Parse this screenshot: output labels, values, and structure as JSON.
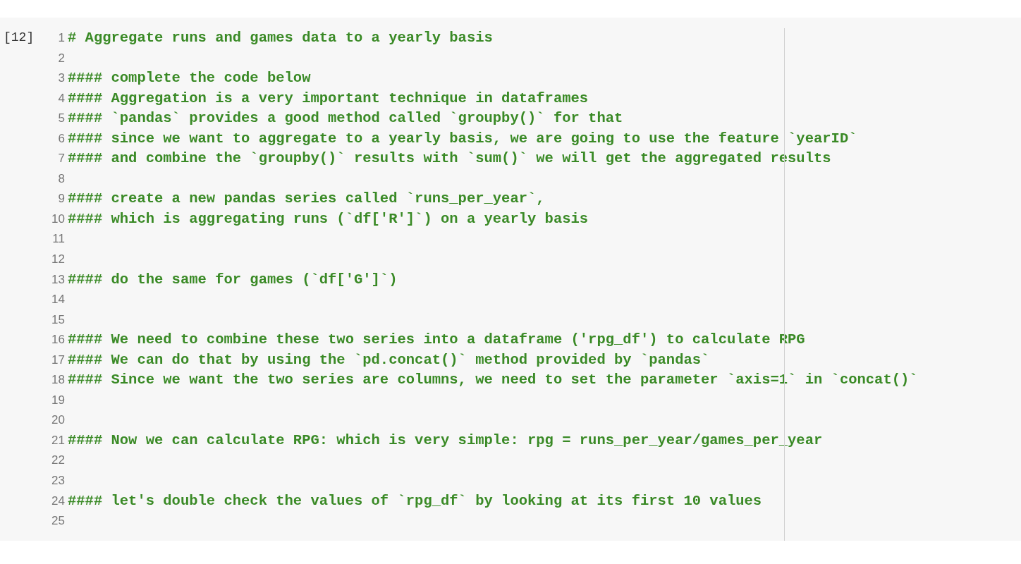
{
  "cell": {
    "execution_count": "[12]",
    "lines": [
      {
        "number": "1",
        "text": "# Aggregate runs and games data to a yearly basis"
      },
      {
        "number": "2"
      },
      {
        "number": "3",
        "text": "#### complete the code below"
      },
      {
        "number": "4",
        "text": "#### Aggregation is a very important technique in dataframes"
      },
      {
        "number": "5",
        "text": "#### `pandas` provides a good method called `groupby()` for that"
      },
      {
        "number": "6",
        "text": "#### since we want to aggregate to a yearly basis, we are going to use the feature `yearID`"
      },
      {
        "number": "7",
        "text": "#### and combine the `groupby()` results with `sum()` we will get the aggregated results"
      },
      {
        "number": "8"
      },
      {
        "number": "9",
        "text": "#### create a new pandas series called `runs_per_year`,"
      },
      {
        "number": "10",
        "text": "#### which is aggregating runs (`df['R']`) on a yearly basis"
      },
      {
        "number": "11"
      },
      {
        "number": "12"
      },
      {
        "number": "13",
        "text": "#### do the same for games (`df['G']`)"
      },
      {
        "number": "14"
      },
      {
        "number": "15"
      },
      {
        "number": "16",
        "text": "#### We need to combine these two series into a dataframe ('rpg_df') to calculate RPG"
      },
      {
        "number": "17",
        "text": "#### We can do that by using the `pd.concat()` method provided by `pandas`"
      },
      {
        "number": "18",
        "text": "#### Since we want the two series are columns, we need to set the parameter `axis=1` in `concat()`"
      },
      {
        "number": "19"
      },
      {
        "number": "20"
      },
      {
        "number": "21",
        "text": "#### Now we can calculate RPG: which is very simple: rpg = runs_per_year/games_per_year"
      },
      {
        "number": "22"
      },
      {
        "number": "23"
      },
      {
        "number": "24",
        "text": "#### let's double check the values of `rpg_df` by looking at its first 10 values"
      },
      {
        "number": "25"
      }
    ]
  }
}
